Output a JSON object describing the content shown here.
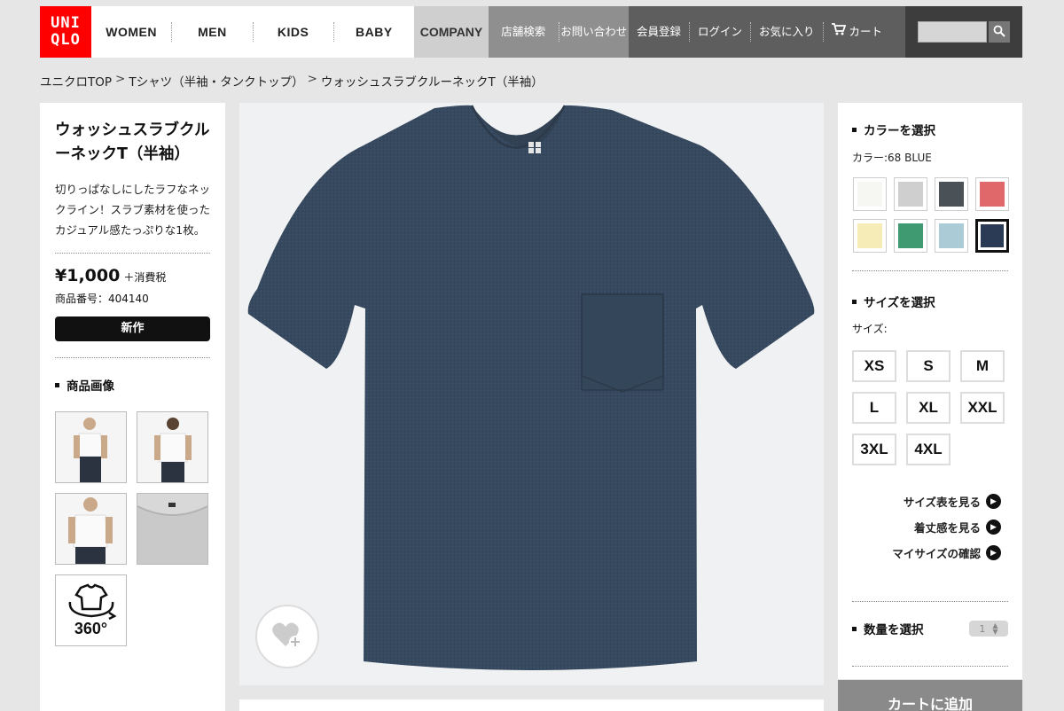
{
  "logo": {
    "line1": "UNI",
    "line2": "QLO"
  },
  "nav": {
    "main": [
      "WOMEN",
      "MEN",
      "KIDS",
      "BABY"
    ],
    "company": "COMPANY",
    "info": [
      "店舗検索",
      "お問い合わせ"
    ],
    "user": [
      "会員登録",
      "ログイン",
      "お気に入り",
      "カート"
    ]
  },
  "search": {
    "placeholder": ""
  },
  "breadcrumb": {
    "items": [
      "ユニクロTOP",
      "Tシャツ（半袖・タンクトップ）",
      "ウォッシュスラブクルーネックT（半袖）"
    ],
    "separator": ">"
  },
  "product": {
    "title": "ウォッシュスラブクルーネックT（半袖）",
    "description": "切りっぱなしにしたラフなネックライン！スラブ素材を使ったカジュアル感たっぷりな1枚。",
    "price": "¥1,000",
    "tax": "＋消費税",
    "item_number": "商品番号：404140",
    "badge": "新作",
    "images_heading": "商品画像",
    "view360": "360°"
  },
  "color": {
    "heading": "カラーを選択",
    "label": "カラー:68 BLUE",
    "swatches": [
      "#f6f6f3",
      "#cfcfcf",
      "#4a5258",
      "#e0686a",
      "#f5ecb8",
      "#3f9a72",
      "#abcbd6",
      "#2c3b55"
    ],
    "selected_index": 7
  },
  "size": {
    "heading": "サイズを選択",
    "label": "サイズ:",
    "options": [
      "XS",
      "S",
      "M",
      "L",
      "XL",
      "XXL",
      "3XL",
      "4XL"
    ]
  },
  "links": [
    "サイズ表を見る",
    "着丈感を見る",
    "マイサイズの確認"
  ],
  "quantity": {
    "heading": "数量を選択",
    "value": "1"
  },
  "cart_button": "カートに追加",
  "colors": {
    "brand": "#ff0000",
    "shirt": "#37495e"
  }
}
